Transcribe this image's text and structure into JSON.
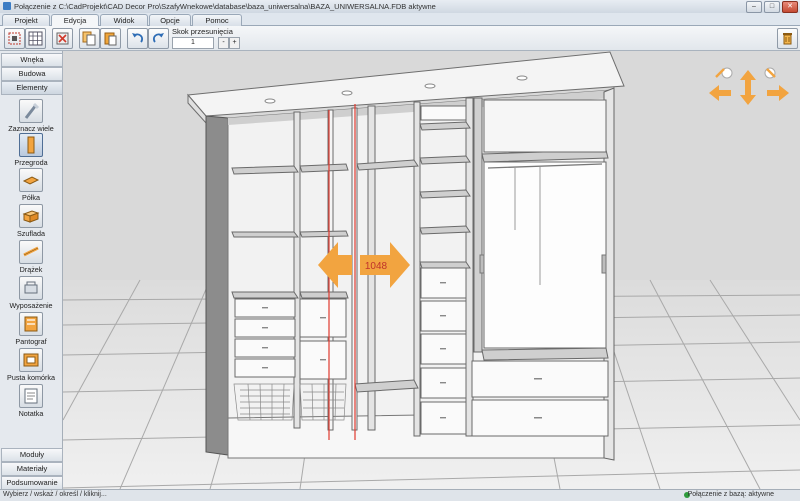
{
  "window": {
    "title": "Połączenie z C:\\CadProjekt\\CAD Decor Pro\\SzafyWnekowe\\database\\baza_uniwersalna\\BAZA_UNIWERSALNA.FDB aktywne"
  },
  "menu_tabs": [
    {
      "label": "Projekt"
    },
    {
      "label": "Edycja"
    },
    {
      "label": "Widok"
    },
    {
      "label": "Opcje"
    },
    {
      "label": "Pomoc"
    }
  ],
  "active_tab": "Edycja",
  "toolbar": {
    "step_label": "Skok przesunięcia",
    "step_value": "1",
    "minus": "-",
    "plus": "+"
  },
  "sidebar": {
    "top_tabs": [
      {
        "label": "Wnęka"
      },
      {
        "label": "Budowa"
      },
      {
        "label": "Elementy"
      }
    ],
    "items": [
      {
        "label": "Zaznacz wiele"
      },
      {
        "label": "Przegroda"
      },
      {
        "label": "Półka"
      },
      {
        "label": "Szuflada"
      },
      {
        "label": "Drążek"
      },
      {
        "label": "Wyposażenie"
      },
      {
        "label": "Pantograf"
      },
      {
        "label": "Pusta komórka"
      },
      {
        "label": "Notatka"
      }
    ],
    "selected_item": "Przegroda",
    "bottom_tabs": [
      {
        "label": "Moduły"
      },
      {
        "label": "Materiały"
      },
      {
        "label": "Podsumowanie"
      }
    ]
  },
  "viewport": {
    "dimension_label": "1048",
    "accent_color": "#f2a440",
    "selection_color": "#e03a2e"
  },
  "status": {
    "left": "Wybierz / wskaż / określ / kliknij...",
    "right": "Połączenie z bazą: aktywne"
  }
}
